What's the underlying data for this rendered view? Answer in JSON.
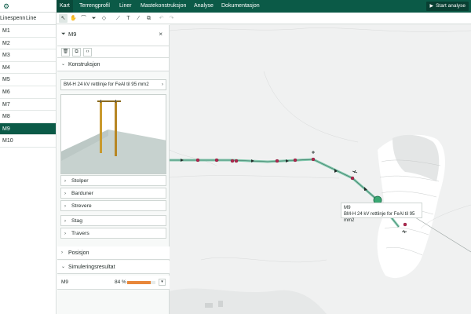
{
  "app": {
    "logo_icon": "gear-icon"
  },
  "nav": {
    "tabs": [
      {
        "label": "Kart",
        "active": true
      },
      {
        "label": "Terrengprofil"
      },
      {
        "label": "Liner"
      },
      {
        "label": "Mastekonstruksjon"
      },
      {
        "label": "Analyse"
      },
      {
        "label": "Dokumentasjon"
      }
    ],
    "start_button": "Start analyse"
  },
  "toolbar": {
    "icons": [
      "select-icon",
      "pan-icon",
      "curve-icon",
      "funnel-icon",
      "node-icon",
      "ruler-icon",
      "text-icon",
      "line-icon",
      "clip-icon",
      "undo-icon",
      "redo-icon"
    ]
  },
  "linelist": {
    "tabs": [
      "Linespenn",
      "Line"
    ],
    "items": [
      "M1",
      "M2",
      "M3",
      "M4",
      "M5",
      "M6",
      "M7",
      "M8",
      "M9",
      "M10"
    ],
    "selected": "M9"
  },
  "panel": {
    "title": "M9",
    "section_konstruksjon": "Konstruksjon",
    "type_value": "BM-H 24 kV rettlinje for FeAl til 95 mm2",
    "accordions": [
      "Stolper",
      "Barduner",
      "Strevere",
      "Stag",
      "Travers"
    ],
    "section_posisjon": "Posisjon",
    "section_sim": "Simuleringsresultat",
    "sim": {
      "name": "M9",
      "percent_label": "84 %",
      "percent": 84
    }
  },
  "tooltip": {
    "title": "M9",
    "subtitle": "BM-H 24 kV rettlinje for FeAl til 95 mm2"
  },
  "colors": {
    "brand": "#0b5a47",
    "line": "#6fbfa0",
    "pole": "#b0284f",
    "sim_bar": "#e8873a"
  }
}
